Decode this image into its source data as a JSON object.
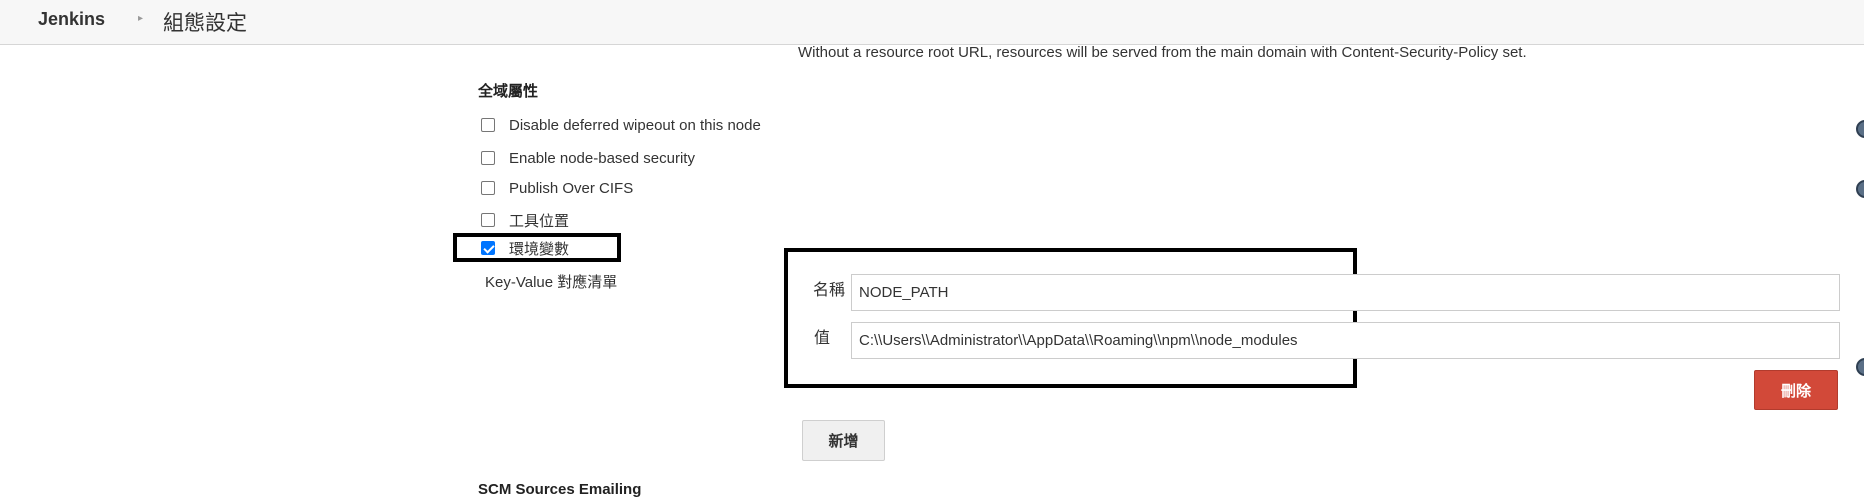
{
  "header": {
    "brand": "Jenkins",
    "breadcrumb": "組態設定"
  },
  "help_text": "Without a resource root URL, resources will be served from the main domain with Content-Security-Policy set.",
  "global_properties": {
    "title": "全域屬性",
    "options": [
      {
        "label": "Disable deferred wipeout on this node",
        "checked": false
      },
      {
        "label": "Enable node-based security",
        "checked": false
      },
      {
        "label": "Publish Over CIFS",
        "checked": false
      },
      {
        "label": "工具位置",
        "checked": false
      },
      {
        "label": "環境變數",
        "checked": true
      }
    ]
  },
  "env_vars": {
    "kv_label": "Key-Value 對應清單",
    "name_label": "名稱",
    "name_value": "NODE_PATH",
    "value_label": "值",
    "value_value": "C:\\\\Users\\\\Administrator\\\\AppData\\\\Roaming\\\\npm\\\\node_modules",
    "delete_button": "刪除",
    "add_button": "新增"
  },
  "next_section_title": "SCM Sources Emailing",
  "colors": {
    "delete_button": "#d24939",
    "checkbox_checked": "#0075ff",
    "help_icon": "#5a6f86"
  }
}
